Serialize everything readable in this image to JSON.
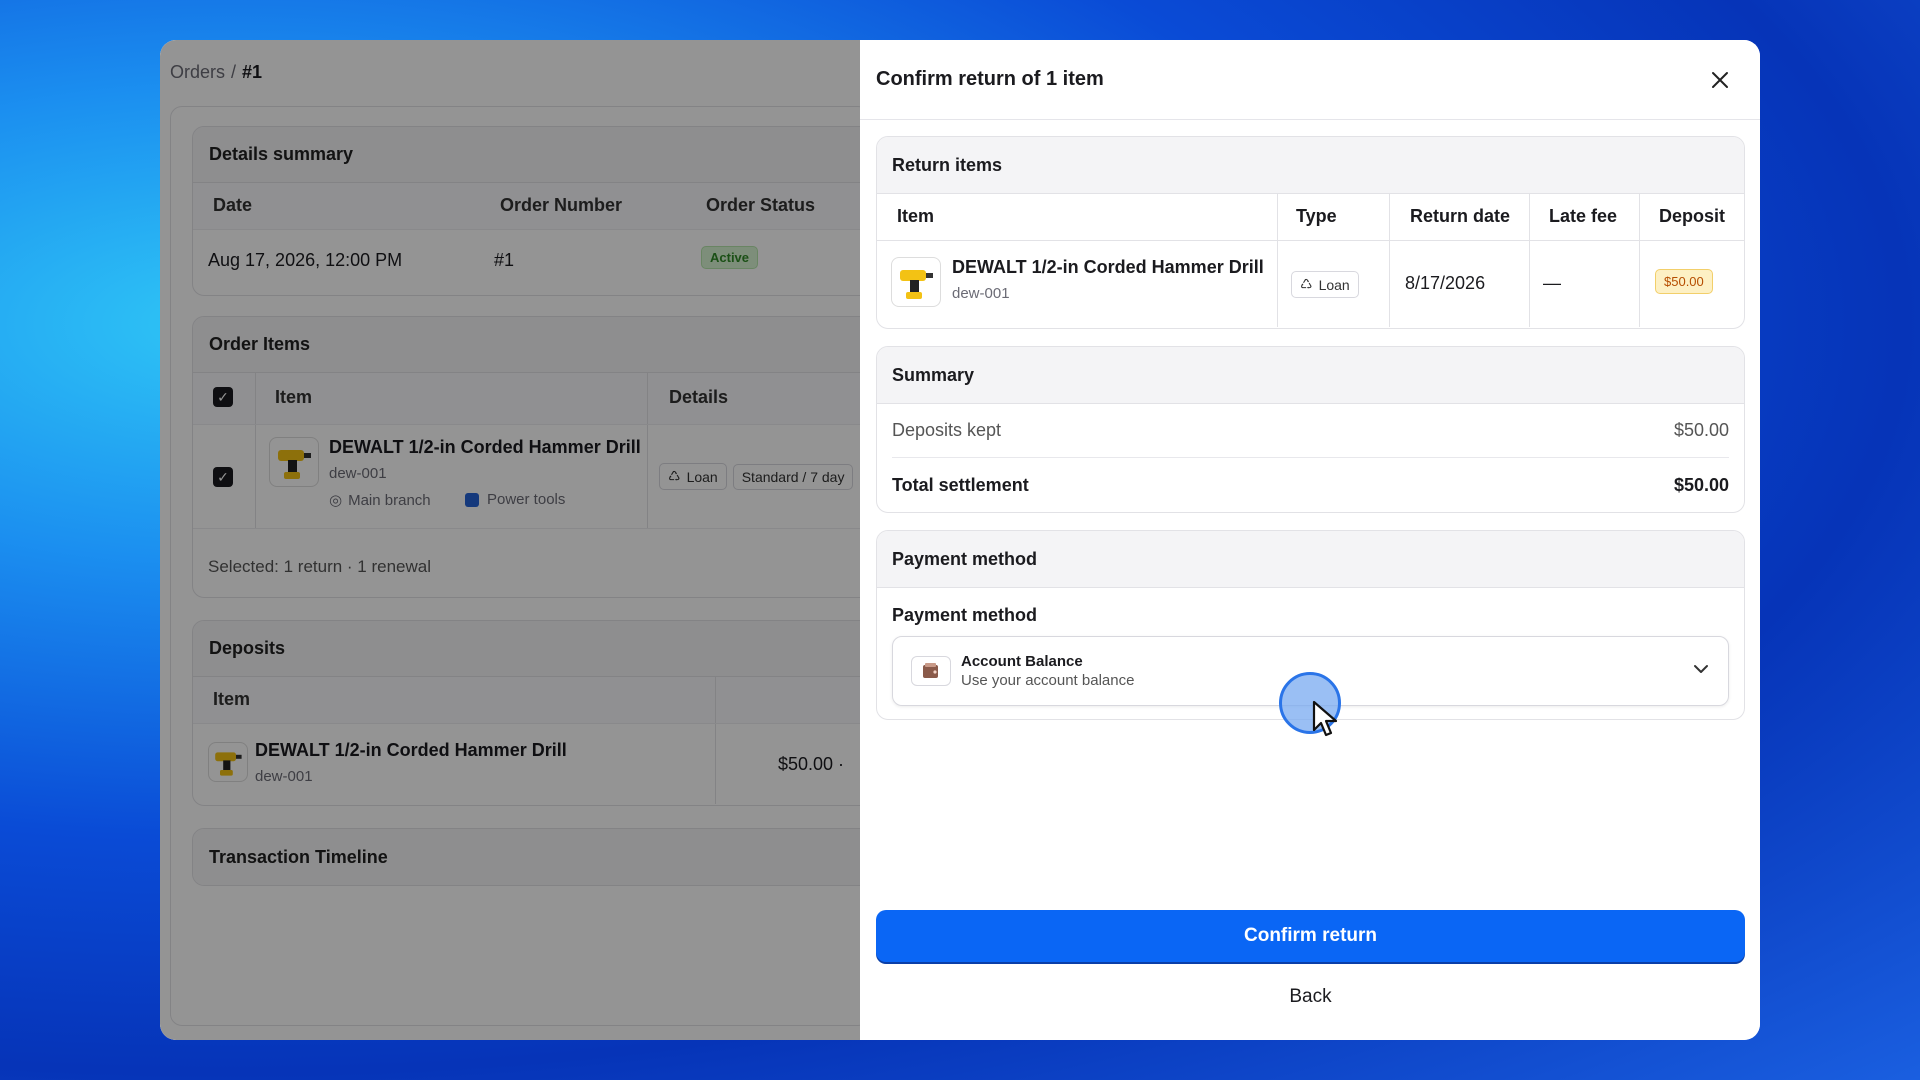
{
  "breadcrumb": {
    "parent": "Orders",
    "separator": "/",
    "current": "#1"
  },
  "details_summary": {
    "title": "Details summary",
    "columns": [
      "Date",
      "Order Number",
      "Order Status"
    ],
    "date": "Aug 17, 2026, 12:00 PM",
    "order_number": "#1",
    "status": "Active"
  },
  "order_items": {
    "title": "Order Items",
    "columns": [
      "Item",
      "Details"
    ],
    "item_name": "DEWALT 1/2-in Corded Hammer Drill",
    "sku": "dew-001",
    "location": "Main branch",
    "category": "Power tools",
    "type_chip": "Loan",
    "plan_chip": "Standard / 7 day",
    "selected_text": "Selected: 1 return · 1 renewal"
  },
  "deposits": {
    "title": "Deposits",
    "columns": [
      "Item"
    ],
    "item_name": "DEWALT 1/2-in Corded Hammer Drill",
    "sku": "dew-001",
    "amount": "$50.00 ·"
  },
  "timeline": {
    "title": "Transaction Timeline"
  },
  "modal": {
    "title": "Confirm return of 1 item",
    "return_items": {
      "title": "Return items",
      "columns": {
        "item": "Item",
        "type": "Type",
        "return_date": "Return date",
        "late_fee": "Late fee",
        "deposit": "Deposit"
      },
      "row": {
        "name": "DEWALT 1/2-in Corded Hammer Drill",
        "sku": "dew-001",
        "type": "Loan",
        "return_date": "8/17/2026",
        "late_fee": "—",
        "deposit": "$50.00"
      }
    },
    "summary": {
      "title": "Summary",
      "deposits_kept_label": "Deposits kept",
      "deposits_kept_value": "$50.00",
      "total_label": "Total settlement",
      "total_value": "$50.00"
    },
    "payment": {
      "title": "Payment method",
      "field_label": "Payment method",
      "selected_title": "Account Balance",
      "selected_subtitle": "Use your account balance"
    },
    "confirm_label": "Confirm return",
    "back_label": "Back"
  },
  "colors": {
    "primary": "#0a66f5",
    "active_badge": "#2f8a26",
    "deposit_badge": "#b64d00"
  }
}
